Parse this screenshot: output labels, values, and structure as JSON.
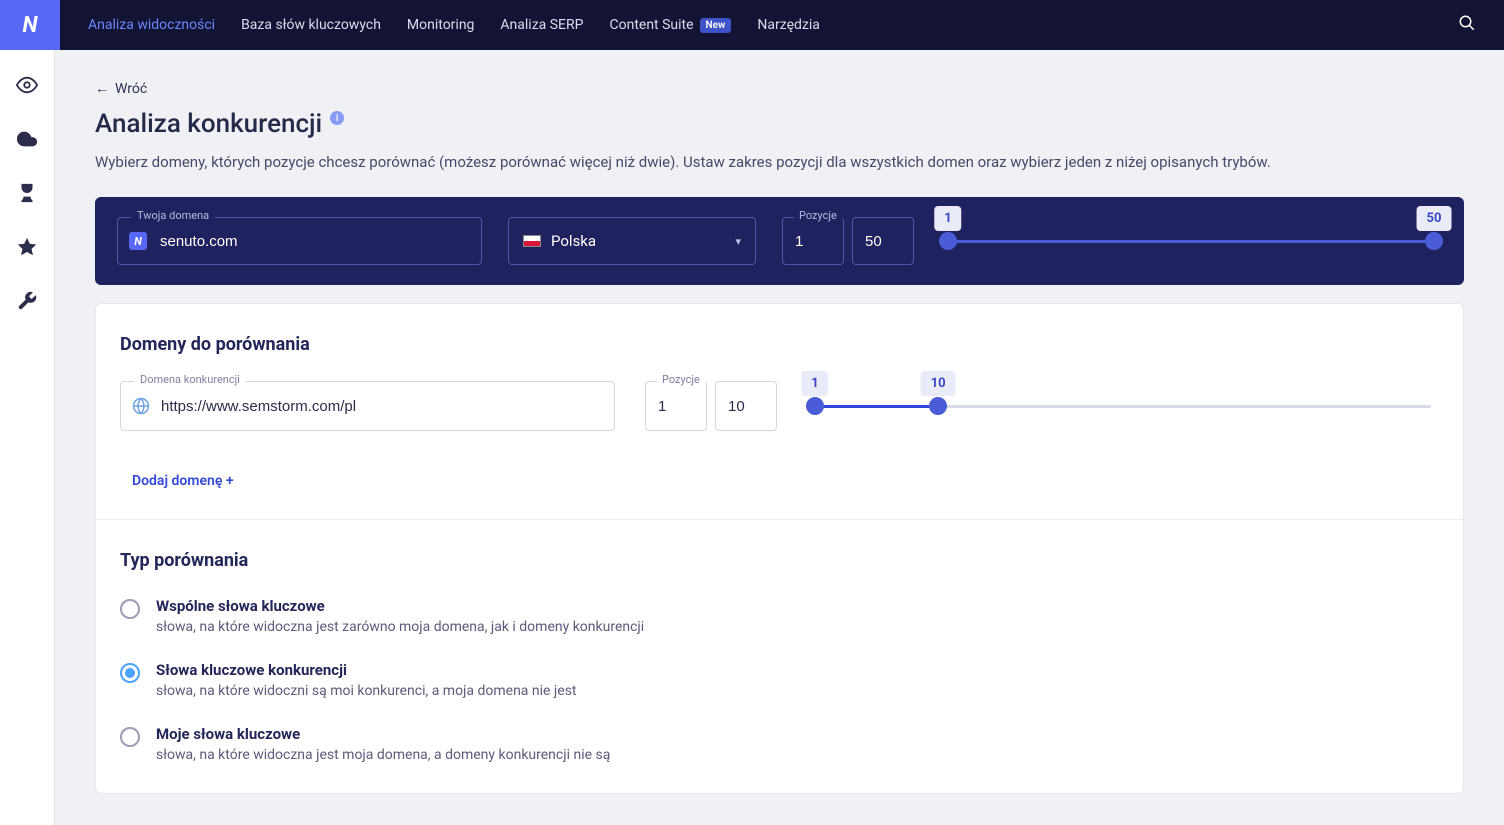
{
  "topnav": {
    "items": [
      {
        "label": "Analiza widoczności"
      },
      {
        "label": "Baza słów kluczowych"
      },
      {
        "label": "Monitoring"
      },
      {
        "label": "Analiza SERP"
      },
      {
        "label": "Content Suite",
        "badge": "New"
      },
      {
        "label": "Narzędzia"
      }
    ]
  },
  "back": "Wróć",
  "page_title": "Analiza konkurencji",
  "page_subtitle": "Wybierz domeny, których pozycje chcesz porównać (możesz porównać więcej niż dwie). Ustaw zakres pozycji dla wszystkich domen oraz wybierz jeden z niżej opisanych trybów.",
  "your_domain": {
    "label": "Twoja domena",
    "value": "senuto.com",
    "country": "Polska",
    "pos_label": "Pozycje",
    "pos_from": "1",
    "pos_to": "50",
    "slider_min": "1",
    "slider_max": "50"
  },
  "compare_section": {
    "title": "Domeny do porównania",
    "domain_label": "Domena konkurencji",
    "domain_value": "https://www.semstorm.com/pl",
    "pos_label": "Pozycje",
    "pos_from": "1",
    "pos_to": "10",
    "slider_min": "1",
    "slider_max": "10",
    "add_label": "Dodaj domenę +"
  },
  "type_section": {
    "title": "Typ porównania",
    "options": [
      {
        "title": "Wspólne słowa kluczowe",
        "desc": "słowa, na które widoczna jest zarówno moja domena, jak i domeny konkurencji"
      },
      {
        "title": "Słowa kluczowe konkurencji",
        "desc": "słowa, na które widoczni są moi konkurenci, a moja domena nie jest"
      },
      {
        "title": "Moje słowa kluczowe",
        "desc": "słowa, na które widoczna jest moja domena, a domeny konkurencji nie są"
      }
    ]
  }
}
